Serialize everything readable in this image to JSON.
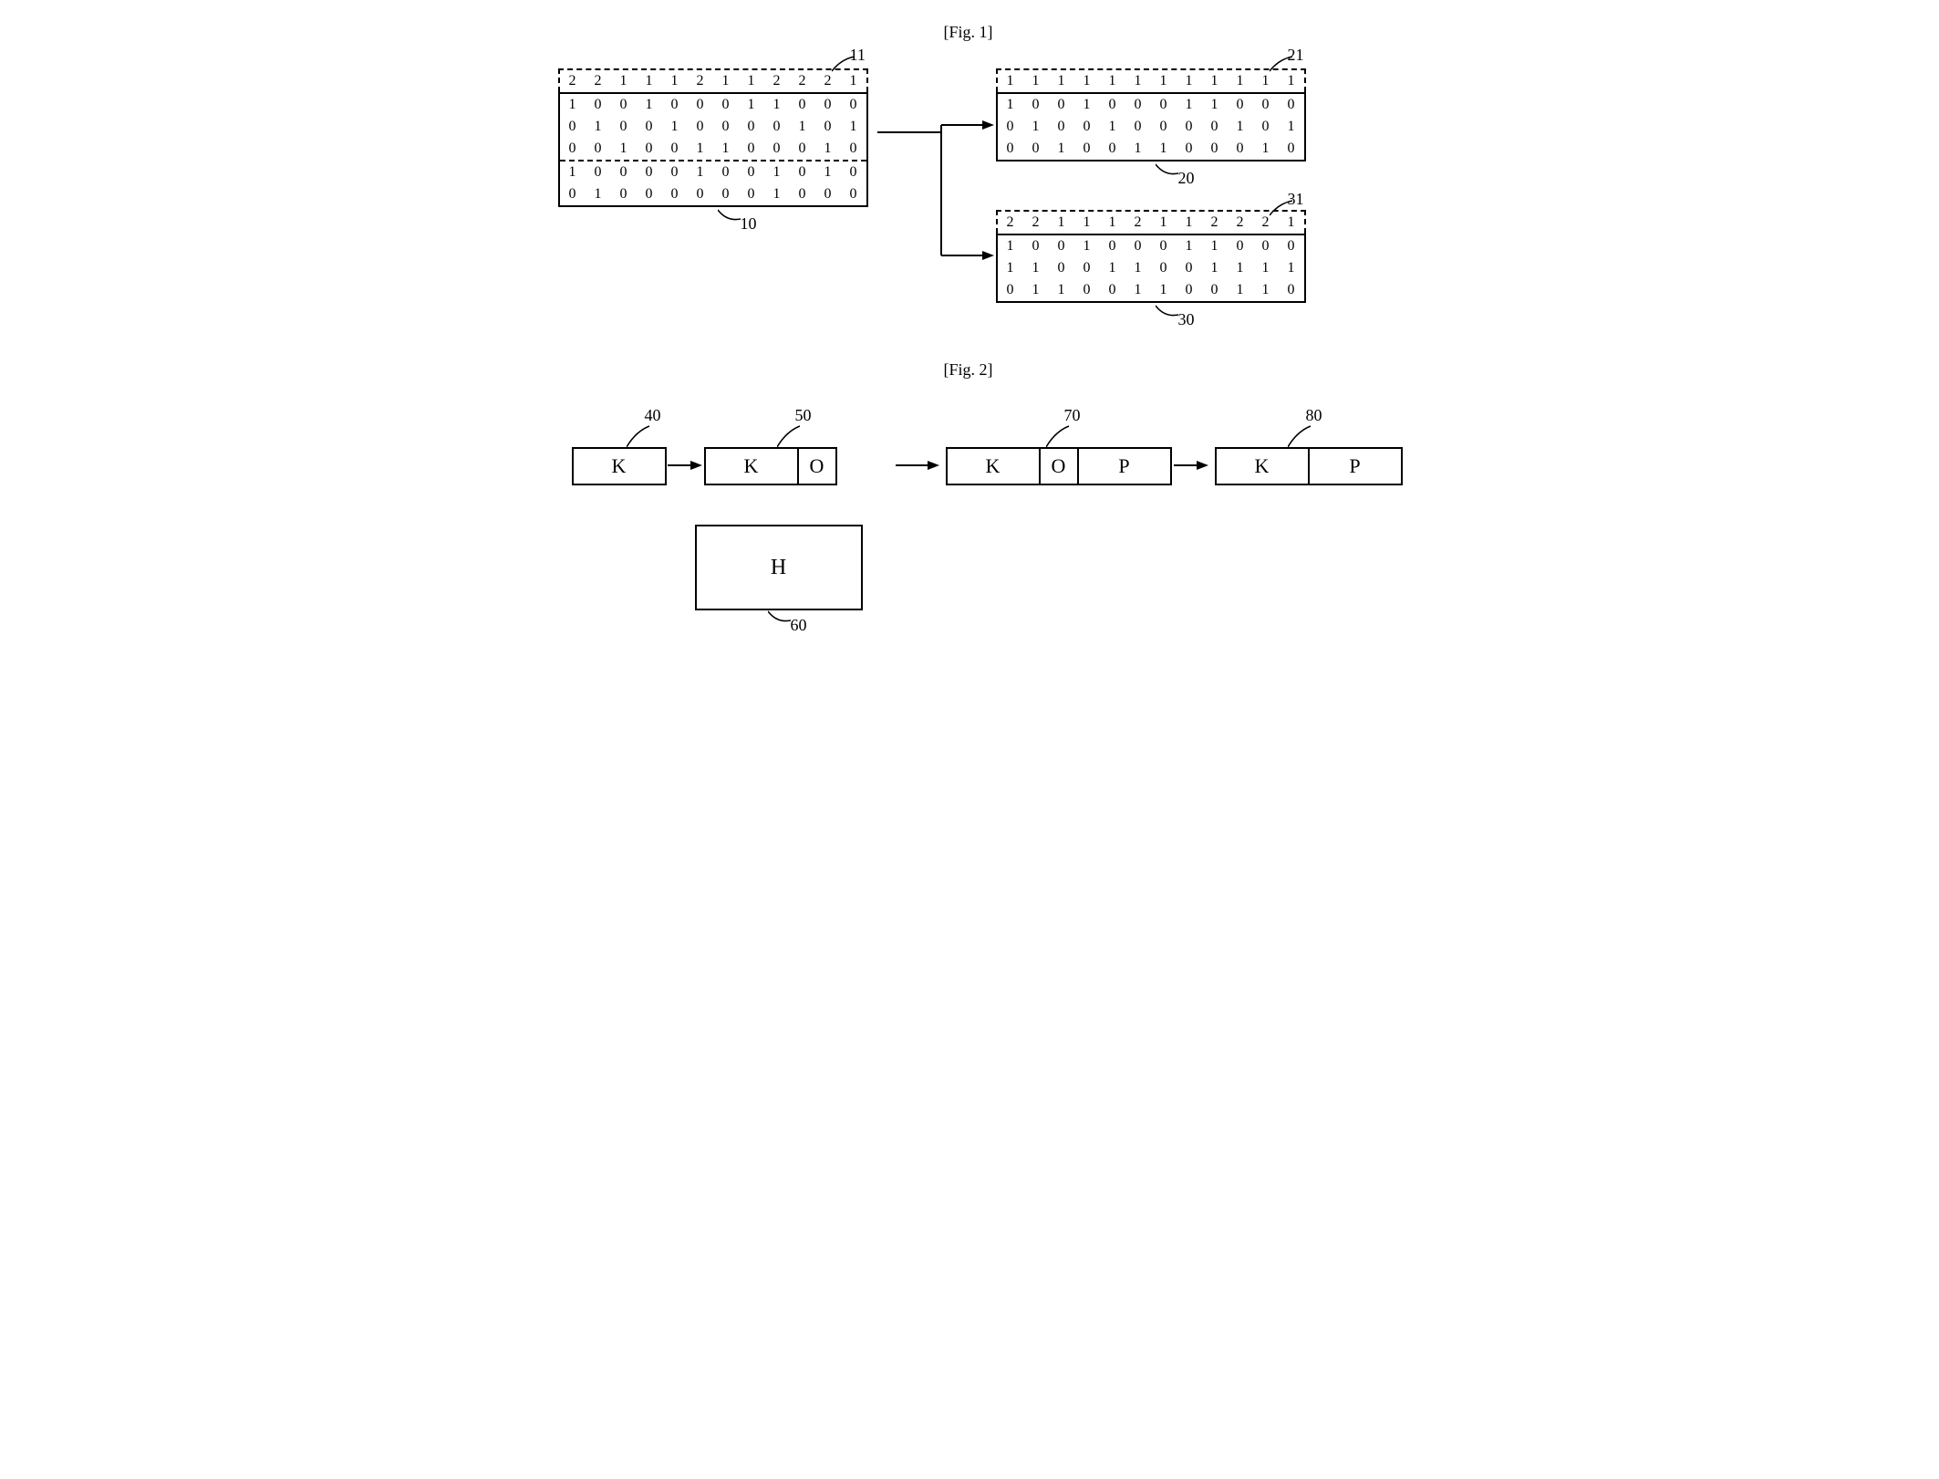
{
  "fig1": {
    "label": "[Fig. 1]",
    "matrix10": {
      "ref": "10",
      "header_ref": "11",
      "header": [
        "2",
        "2",
        "1",
        "1",
        "1",
        "2",
        "1",
        "1",
        "2",
        "2",
        "2",
        "1"
      ],
      "rows": [
        [
          "1",
          "0",
          "0",
          "1",
          "0",
          "0",
          "0",
          "1",
          "1",
          "0",
          "0",
          "0"
        ],
        [
          "0",
          "1",
          "0",
          "0",
          "1",
          "0",
          "0",
          "0",
          "0",
          "1",
          "0",
          "1"
        ],
        [
          "0",
          "0",
          "1",
          "0",
          "0",
          "1",
          "1",
          "0",
          "0",
          "0",
          "1",
          "0"
        ],
        [
          "1",
          "0",
          "0",
          "0",
          "0",
          "1",
          "0",
          "0",
          "1",
          "0",
          "1",
          "0"
        ],
        [
          "0",
          "1",
          "0",
          "0",
          "0",
          "0",
          "0",
          "0",
          "1",
          "0",
          "0",
          "0"
        ]
      ],
      "divider_after_row": 3
    },
    "matrix20": {
      "ref": "20",
      "header_ref": "21",
      "header": [
        "1",
        "1",
        "1",
        "1",
        "1",
        "1",
        "1",
        "1",
        "1",
        "1",
        "1",
        "1"
      ],
      "rows": [
        [
          "1",
          "0",
          "0",
          "1",
          "0",
          "0",
          "0",
          "1",
          "1",
          "0",
          "0",
          "0"
        ],
        [
          "0",
          "1",
          "0",
          "0",
          "1",
          "0",
          "0",
          "0",
          "0",
          "1",
          "0",
          "1"
        ],
        [
          "0",
          "0",
          "1",
          "0",
          "0",
          "1",
          "1",
          "0",
          "0",
          "0",
          "1",
          "0"
        ]
      ]
    },
    "matrix30": {
      "ref": "30",
      "header_ref": "31",
      "header": [
        "2",
        "2",
        "1",
        "1",
        "1",
        "2",
        "1",
        "1",
        "2",
        "2",
        "2",
        "1"
      ],
      "rows": [
        [
          "1",
          "0",
          "0",
          "1",
          "0",
          "0",
          "0",
          "1",
          "1",
          "0",
          "0",
          "0"
        ],
        [
          "1",
          "1",
          "0",
          "0",
          "1",
          "1",
          "0",
          "0",
          "1",
          "1",
          "1",
          "1"
        ],
        [
          "0",
          "1",
          "1",
          "0",
          "0",
          "1",
          "1",
          "0",
          "0",
          "1",
          "1",
          "0"
        ]
      ]
    }
  },
  "fig2": {
    "label": "[Fig. 2]",
    "box40": {
      "ref": "40",
      "cells": [
        "K"
      ],
      "widths": [
        100
      ]
    },
    "box50": {
      "ref": "50",
      "cells": [
        "K",
        "O"
      ],
      "widths": [
        100,
        40
      ]
    },
    "box60": {
      "ref": "60",
      "label": "H"
    },
    "box70": {
      "ref": "70",
      "cells": [
        "K",
        "O",
        "P"
      ],
      "widths": [
        100,
        40,
        100
      ]
    },
    "box80": {
      "ref": "80",
      "cells": [
        "K",
        "P"
      ],
      "widths": [
        100,
        100
      ]
    }
  }
}
